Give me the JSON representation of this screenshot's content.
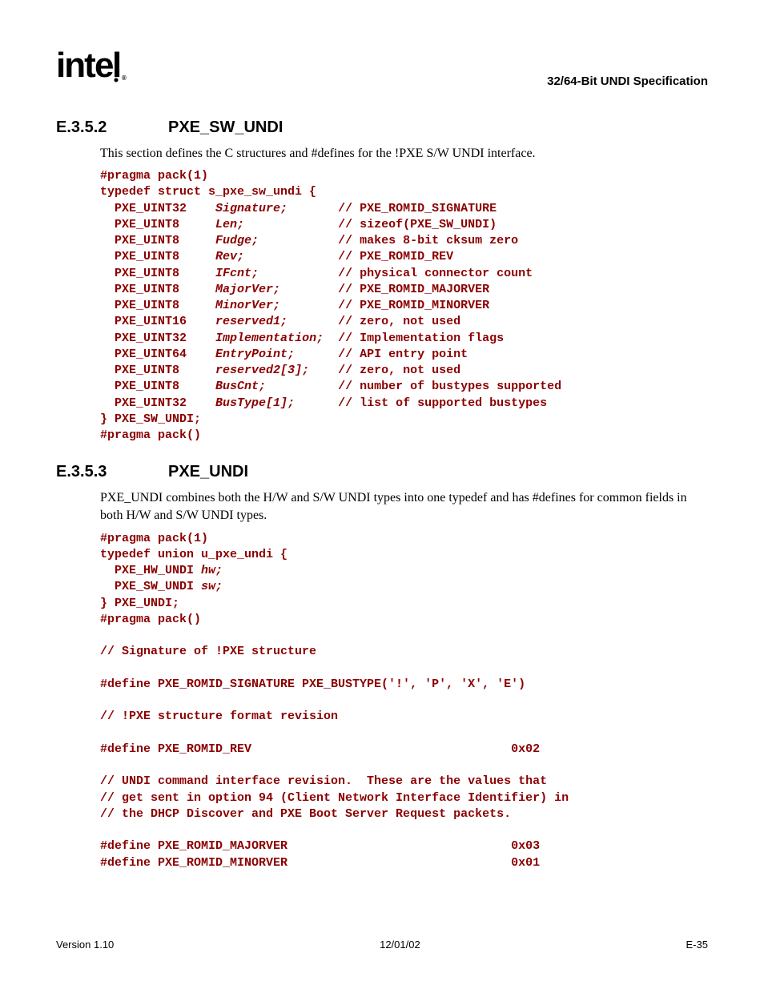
{
  "header": {
    "logo": "intel",
    "spec_title": "32/64-Bit UNDI Specification"
  },
  "section1": {
    "num": "E.3.5.2",
    "title": "PXE_SW_UNDI",
    "intro": "This section defines the C structures and #defines for the !PXE S/W UNDI interface.",
    "code": {
      "l1": "#pragma pack(1)",
      "l2": "typedef struct s_pxe_sw_undi {",
      "l3a": "  PXE_UINT32",
      "l3b": "Signature;",
      "l3c": "// PXE_ROMID_SIGNATURE",
      "l4a": "  PXE_UINT8",
      "l4b": "Len;",
      "l4c": "// sizeof(PXE_SW_UNDI)",
      "l5a": "  PXE_UINT8",
      "l5b": "Fudge;",
      "l5c": "// makes 8-bit cksum zero",
      "l6a": "  PXE_UINT8",
      "l6b": "Rev;",
      "l6c": "// PXE_ROMID_REV",
      "l7a": "  PXE_UINT8",
      "l7b": "IFcnt;",
      "l7c": "// physical connector count",
      "l8a": "  PXE_UINT8",
      "l8b": "MajorVer;",
      "l8c": "// PXE_ROMID_MAJORVER",
      "l9a": "  PXE_UINT8",
      "l9b": "MinorVer;",
      "l9c": "// PXE_ROMID_MINORVER",
      "l10a": "  PXE_UINT16",
      "l10b": "reserved1;",
      "l10c": "// zero, not used",
      "l11a": "  PXE_UINT32",
      "l11b": "Implementation;",
      "l11c": "// Implementation flags",
      "l12a": "  PXE_UINT64",
      "l12b": "EntryPoint;",
      "l12c": "// API entry point",
      "l13a": "  PXE_UINT8",
      "l13b": "reserved2[3];",
      "l13c": "// zero, not used",
      "l14a": "  PXE_UINT8",
      "l14b": "BusCnt;",
      "l14c": "// number of bustypes supported",
      "l15a": "  PXE_UINT32",
      "l15b": "BusType[1];",
      "l15c": "// list of supported bustypes",
      "l16": "} PXE_SW_UNDI;",
      "l17": "#pragma pack()"
    }
  },
  "section2": {
    "num": "E.3.5.3",
    "title": "PXE_UNDI",
    "intro": "PXE_UNDI combines both the H/W and S/W UNDI types into one typedef and has #defines for common fields in both H/W and S/W UNDI types.",
    "code": {
      "l1": "#pragma pack(1)",
      "l2": "typedef union u_pxe_undi {",
      "l3a": "  PXE_HW_UNDI ",
      "l3b": "hw;",
      "l4a": "  PXE_SW_UNDI ",
      "l4b": "sw;",
      "l5": "} PXE_UNDI;",
      "l6": "#pragma pack()",
      "blank1": "",
      "l7": "// Signature of !PXE structure",
      "blank2": "",
      "l8": "#define PXE_ROMID_SIGNATURE PXE_BUSTYPE('!', 'P', 'X', 'E')",
      "blank3": "",
      "l9": "// !PXE structure format revision",
      "blank4": "",
      "l10a": "#define PXE_ROMID_REV",
      "l10b": "0x02",
      "blank5": "",
      "l11": "// UNDI command interface revision.  These are the values that",
      "l12": "// get sent in option 94 (Client Network Interface Identifier) in",
      "l13": "// the DHCP Discover and PXE Boot Server Request packets.",
      "blank6": "",
      "l14a": "#define PXE_ROMID_MAJORVER",
      "l14b": "0x03",
      "l15a": "#define PXE_ROMID_MINORVER",
      "l15b": "0x01"
    }
  },
  "footer": {
    "left": "Version 1.10",
    "center": "12/01/02",
    "right": "E-35"
  }
}
